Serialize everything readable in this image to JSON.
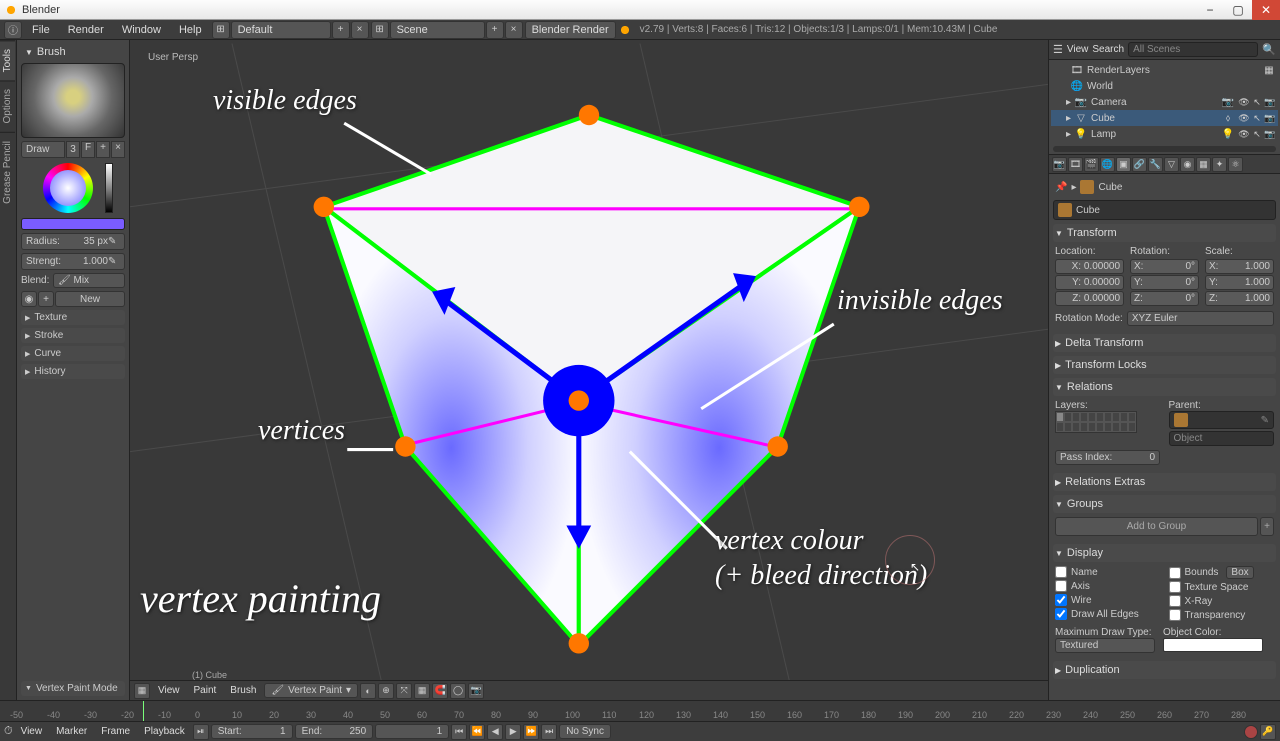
{
  "app": {
    "title": "Blender"
  },
  "win": {
    "min": "−",
    "max": "▢",
    "close": "✕"
  },
  "menu": {
    "file": "File",
    "render": "Render",
    "window": "Window",
    "help": "Help",
    "layout": "Default",
    "scene": "Scene",
    "engine": "Blender Render",
    "stats": "v2.79 | Verts:8 | Faces:6 | Tris:12 | Objects:1/3 | Lamps:0/1 | Mem:10.43M | Cube"
  },
  "ltabs": {
    "tools": "Tools",
    "options": "Options",
    "gp": "Grease Pencil"
  },
  "brush": {
    "header": "Brush",
    "name": "Draw",
    "users": "3",
    "fake": "F",
    "radius_label": "Radius:",
    "radius": "35 px",
    "strength_label": "Strengt:",
    "strength": "1.000",
    "blend_label": "Blend:",
    "blend": "Mix",
    "new": "New"
  },
  "lacc": {
    "texture": "Texture",
    "stroke": "Stroke",
    "curve": "Curve",
    "history": "History",
    "vpm": "Vertex Paint Mode"
  },
  "viewport": {
    "persp": "User Persp",
    "hover": "(1) Cube"
  },
  "vphdr": {
    "view": "View",
    "paint": "Paint",
    "brush": "Brush",
    "mode": "Vertex Paint"
  },
  "outhdr": {
    "view": "View",
    "search": "Search",
    "filter": "All Scenes"
  },
  "outliner": {
    "renderlayers": "RenderLayers",
    "world": "World",
    "camera": "Camera",
    "cube": "Cube",
    "lamp": "Lamp"
  },
  "bc": {
    "cube": "Cube"
  },
  "transform": {
    "header": "Transform",
    "loc": "Location:",
    "rot": "Rotation:",
    "scale": "Scale:",
    "lx": "X: 0.00000",
    "ly": "Y: 0.00000",
    "lz": "Z: 0.00000",
    "rx": "X:",
    "ry": "Y:",
    "rz": "Z:",
    "r0": "0°",
    "sx": "X:",
    "sy": "Y:",
    "sz": "Z:",
    "s1": "1.000",
    "rotmode_label": "Rotation Mode:",
    "rotmode": "XYZ Euler"
  },
  "sections": {
    "dtransform": "Delta Transform",
    "tlocks": "Transform Locks",
    "relations": "Relations",
    "relextras": "Relations Extras",
    "groups": "Groups",
    "display": "Display",
    "dup": "Duplication"
  },
  "relations": {
    "layers": "Layers:",
    "parent": "Parent:",
    "object": "Object",
    "passidx_label": "Pass Index:",
    "passidx": "0"
  },
  "groups": {
    "add": "Add to Group"
  },
  "display": {
    "name": "Name",
    "axis": "Axis",
    "wire": "Wire",
    "drawedges": "Draw All Edges",
    "bounds": "Bounds",
    "box": "Box",
    "texspace": "Texture Space",
    "xray": "X-Ray",
    "transparency": "Transparency",
    "mdt": "Maximum Draw Type:",
    "mdtv": "Textured",
    "objcol": "Object Color:"
  },
  "timeline": {
    "view": "View",
    "marker": "Marker",
    "frame": "Frame",
    "playback": "Playback",
    "start_label": "Start:",
    "start": "1",
    "end_label": "End:",
    "end": "250",
    "current": "1",
    "sync": "No Sync"
  },
  "annots": {
    "visedges": "visible edges",
    "invisedges": "invisible edges",
    "vertices": "vertices",
    "vcolor1": "vertex colour",
    "vcolor2": "(+ bleed direction)",
    "title": "vertex painting"
  },
  "ticks": [
    "-50",
    "-40",
    "-30",
    "-20",
    "-10",
    "0",
    "10",
    "20",
    "30",
    "40",
    "50",
    "60",
    "70",
    "80",
    "90",
    "100",
    "110",
    "120",
    "130",
    "140",
    "150",
    "160",
    "170",
    "180",
    "190",
    "200",
    "210",
    "220",
    "230",
    "240",
    "250",
    "260",
    "270",
    "280"
  ]
}
